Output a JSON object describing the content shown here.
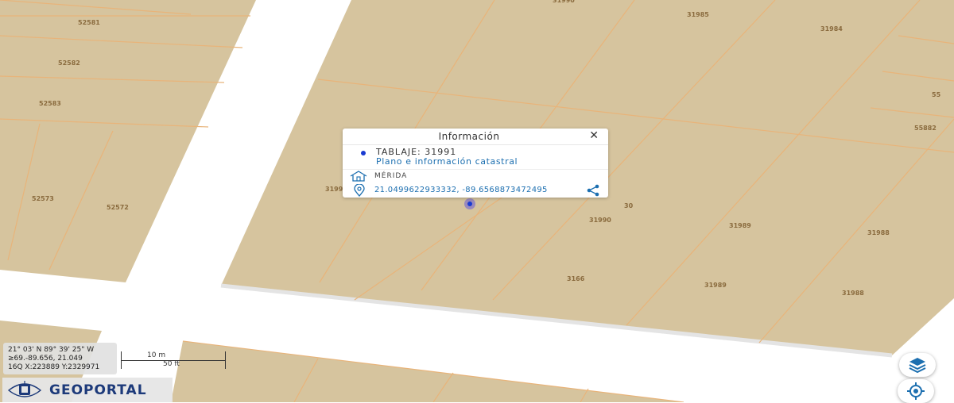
{
  "map": {
    "parcel_labels": [
      "52581",
      "52582",
      "52583",
      "52573",
      "52572",
      "31985",
      "31984",
      "55882",
      "31990",
      "31989",
      "31988",
      "31989",
      "31988",
      "3199",
      "30",
      "3166",
      "31990",
      "55"
    ]
  },
  "popup": {
    "title": "Información",
    "close_icon": "close-icon",
    "tablaje_text": "TABLAJE:  31991",
    "plan_link": "Plano e información catastral",
    "municipality": "MÉRIDA",
    "coordinates": "21.0499622933332, -89.6568873472495",
    "icons": [
      "house-icon",
      "location-pin-icon",
      "share-icon"
    ]
  },
  "coords_box": {
    "line1": "21° 03' N 89° 39' 25\" W",
    "line2": "-89.656, 21.049",
    "line2_prefix": "≥69.",
    "line3": "16Q X:223889 Y:2329971"
  },
  "scale": {
    "top": "10 m",
    "bottom": "50 ft"
  },
  "logo": {
    "text": "GEOPORTAL"
  },
  "colors": {
    "parcel_fill": "#d6c49e",
    "parcel_line": "#e8b47a",
    "road": "#ffffff",
    "accent": "#1c6fb0",
    "logo": "#1d3a7a"
  },
  "controls": {
    "layers": "layers-icon",
    "locate": "locate-icon"
  }
}
